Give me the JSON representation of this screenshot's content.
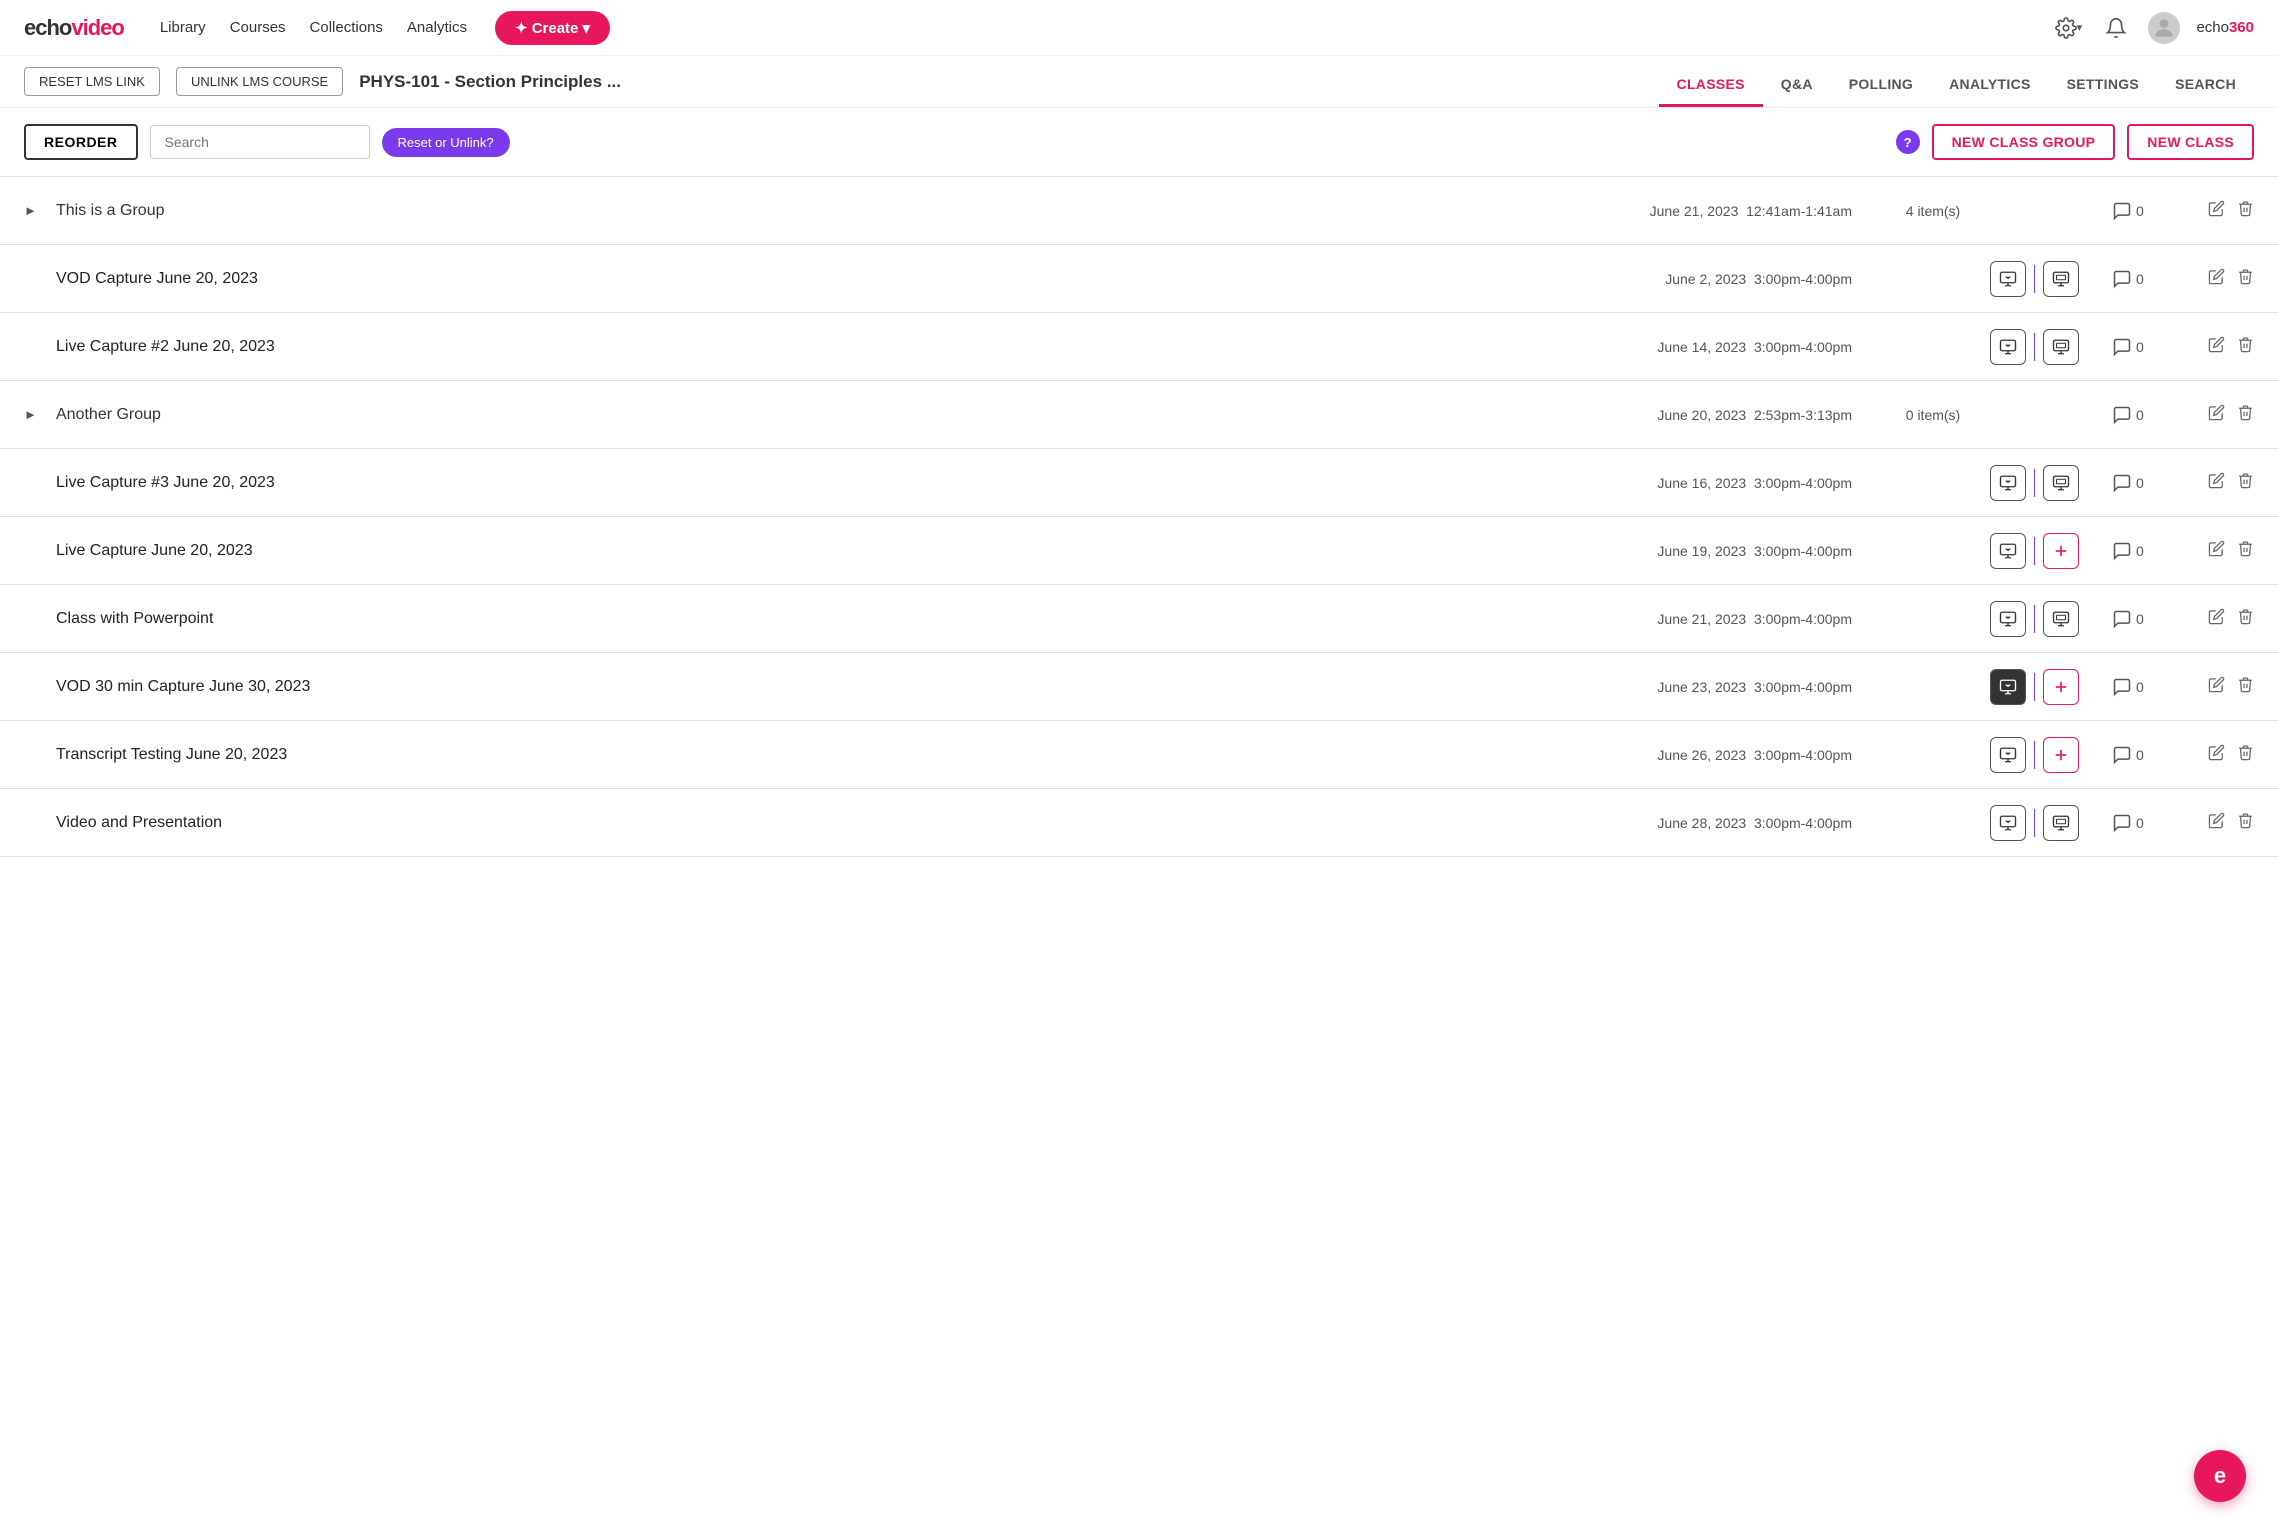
{
  "logo": {
    "text_echo": "echo",
    "text_video": "video"
  },
  "nav": {
    "links": [
      "Library",
      "Courses",
      "Collections",
      "Analytics"
    ],
    "create_label": "✦ Create ▾"
  },
  "nav_right": {
    "settings_label": "⚙",
    "bell_label": "🔔",
    "echo_brand": "echo 360"
  },
  "course_header": {
    "reset_lms_label": "RESET LMS LINK",
    "unlink_lms_label": "UNLINK LMS COURSE",
    "course_title": "PHYS-101 - Section Principles ...",
    "tabs": [
      "CLASSES",
      "Q&A",
      "POLLING",
      "ANALYTICS",
      "SETTINGS",
      "SEARCH"
    ],
    "active_tab": "CLASSES"
  },
  "toolbar": {
    "reorder_label": "REORDER",
    "search_placeholder": "Search",
    "reset_pill_label": "Reset or Unlink?",
    "help_label": "?",
    "new_group_label": "NEW CLASS GROUP",
    "new_class_label": "NEW CLASS"
  },
  "classes": [
    {
      "type": "group",
      "name": "This is a Group",
      "date": "June 21, 2023",
      "time": "12:41am-1:41am",
      "items": "4 item(s)",
      "comments": "0",
      "has_chevron": true,
      "icons": []
    },
    {
      "type": "class",
      "name": "VOD Capture June 20, 2023",
      "date": "June 2, 2023",
      "time": "3:00pm-4:00pm",
      "comments": "0",
      "has_chevron": false,
      "icons": [
        "capture",
        "screen"
      ],
      "icon_style": "normal"
    },
    {
      "type": "class",
      "name": "Live Capture #2 June 20, 2023",
      "date": "June 14, 2023",
      "time": "3:00pm-4:00pm",
      "comments": "0",
      "has_chevron": false,
      "icons": [
        "capture",
        "screen"
      ],
      "icon_style": "normal"
    },
    {
      "type": "group",
      "name": "Another Group",
      "date": "June 20, 2023",
      "time": "2:53pm-3:13pm",
      "items": "0 item(s)",
      "comments": "0",
      "has_chevron": true,
      "icons": []
    },
    {
      "type": "class",
      "name": "Live Capture #3 June 20, 2023",
      "date": "June 16, 2023",
      "time": "3:00pm-4:00pm",
      "comments": "0",
      "has_chevron": false,
      "icons": [
        "capture",
        "screen"
      ],
      "icon_style": "normal"
    },
    {
      "type": "class",
      "name": "Live Capture June 20, 2023",
      "date": "June 19, 2023",
      "time": "3:00pm-4:00pm",
      "comments": "0",
      "has_chevron": false,
      "icons": [
        "capture",
        "plus"
      ],
      "icon_style": "plus-pink"
    },
    {
      "type": "class",
      "name": "Class with Powerpoint",
      "date": "June 21, 2023",
      "time": "3:00pm-4:00pm",
      "comments": "0",
      "has_chevron": false,
      "icons": [
        "capture",
        "screen"
      ],
      "icon_style": "normal"
    },
    {
      "type": "class",
      "name": "VOD 30 min Capture June 30, 2023",
      "date": "June 23, 2023",
      "time": "3:00pm-4:00pm",
      "comments": "0",
      "has_chevron": false,
      "icons": [
        "capture-dark",
        "plus"
      ],
      "icon_style": "dark-plus"
    },
    {
      "type": "class",
      "name": "Transcript Testing June 20, 2023",
      "date": "June 26, 2023",
      "time": "3:00pm-4:00pm",
      "comments": "0",
      "has_chevron": false,
      "icons": [
        "capture",
        "plus"
      ],
      "icon_style": "plus-pink"
    },
    {
      "type": "class",
      "name": "Video and Presentation",
      "date": "June 28, 2023",
      "time": "3:00pm-4:00pm",
      "comments": "0",
      "has_chevron": false,
      "icons": [
        "capture",
        "screen"
      ],
      "icon_style": "normal"
    }
  ],
  "fab": {
    "label": "e"
  }
}
